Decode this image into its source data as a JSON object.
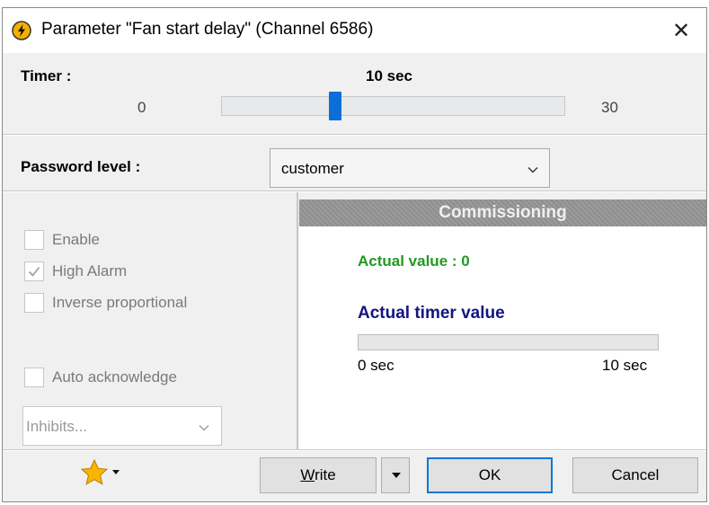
{
  "window": {
    "title": "Parameter \"Fan start delay\" (Channel 6586)",
    "close_glyph": "✕"
  },
  "timer": {
    "label": "Timer :",
    "value_text": "10 sec",
    "min_label": "0",
    "max_label": "30",
    "min": 0,
    "max": 30,
    "value": 10
  },
  "password": {
    "label": "Password level :",
    "selected": "customer"
  },
  "options": {
    "enable": {
      "label": "Enable",
      "checked": false
    },
    "high_alarm": {
      "label": "High Alarm",
      "checked": true
    },
    "inverse": {
      "label": "Inverse proportional",
      "checked": false
    },
    "auto_ack": {
      "label": "Auto acknowledge",
      "checked": false
    },
    "inhibits": {
      "selected": "Inhibits..."
    }
  },
  "commissioning": {
    "header": "Commissioning",
    "actual_value": "Actual value : 0",
    "timer_title": "Actual timer value",
    "progress_fraction": 0,
    "min_label": "0 sec",
    "max_label": "10 sec"
  },
  "buttons": {
    "write": "Write",
    "ok": "OK",
    "cancel": "Cancel"
  },
  "icons": {
    "title": "lightning-icon",
    "favorites": "star-icon"
  },
  "colors": {
    "slider_thumb": "#0a6fd8",
    "ok_border": "#0078d7",
    "actual_value": "#229922",
    "timer_title": "#141482",
    "star": "#f7b500"
  }
}
